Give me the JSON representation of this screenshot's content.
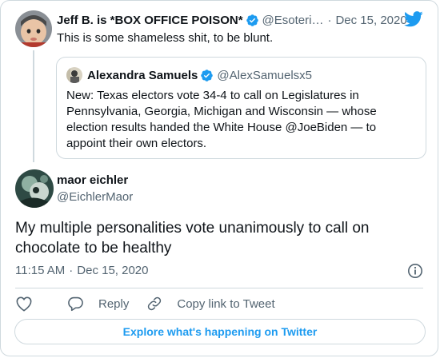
{
  "parent_tweet": {
    "author_name": "Jeff B. is *BOX OFFICE POISON*",
    "handle": "@Esoteri…",
    "date": "Dec 15, 2020",
    "text": "This is some shameless shit, to be blunt.",
    "verified": true
  },
  "quoted_tweet": {
    "author_name": "Alexandra Samuels",
    "handle": "@AlexSamuelsx5",
    "verified": true,
    "text": "New: Texas electors vote 34-4 to call on Legislatures in Pennsylvania, Georgia, Michigan and Wisconsin — whose election results handed the White House @JoeBiden — to appoint their own electors."
  },
  "main_tweet": {
    "author_name": "maor eichler",
    "handle": "@EichlerMaor",
    "text": "My multiple personalities vote unanimously to call on chocolate to be healthy",
    "time": "11:15 AM",
    "separator": "·",
    "date": "Dec 15, 2020"
  },
  "actions": {
    "reply_label": "Reply",
    "copy_link_label": "Copy link to Tweet"
  },
  "explore_label": "Explore what's happening on Twitter",
  "separators": {
    "dot": "·"
  },
  "icons": {
    "brand": "twitter-bird-icon",
    "verified": "verified-badge-icon",
    "info": "info-icon",
    "like": "heart-icon",
    "reply": "reply-bubble-icon",
    "copy_link": "link-icon"
  },
  "colors": {
    "accent": "#1d9bf0",
    "text": "#0f1419",
    "muted": "#536471",
    "border": "#cfd9de"
  }
}
